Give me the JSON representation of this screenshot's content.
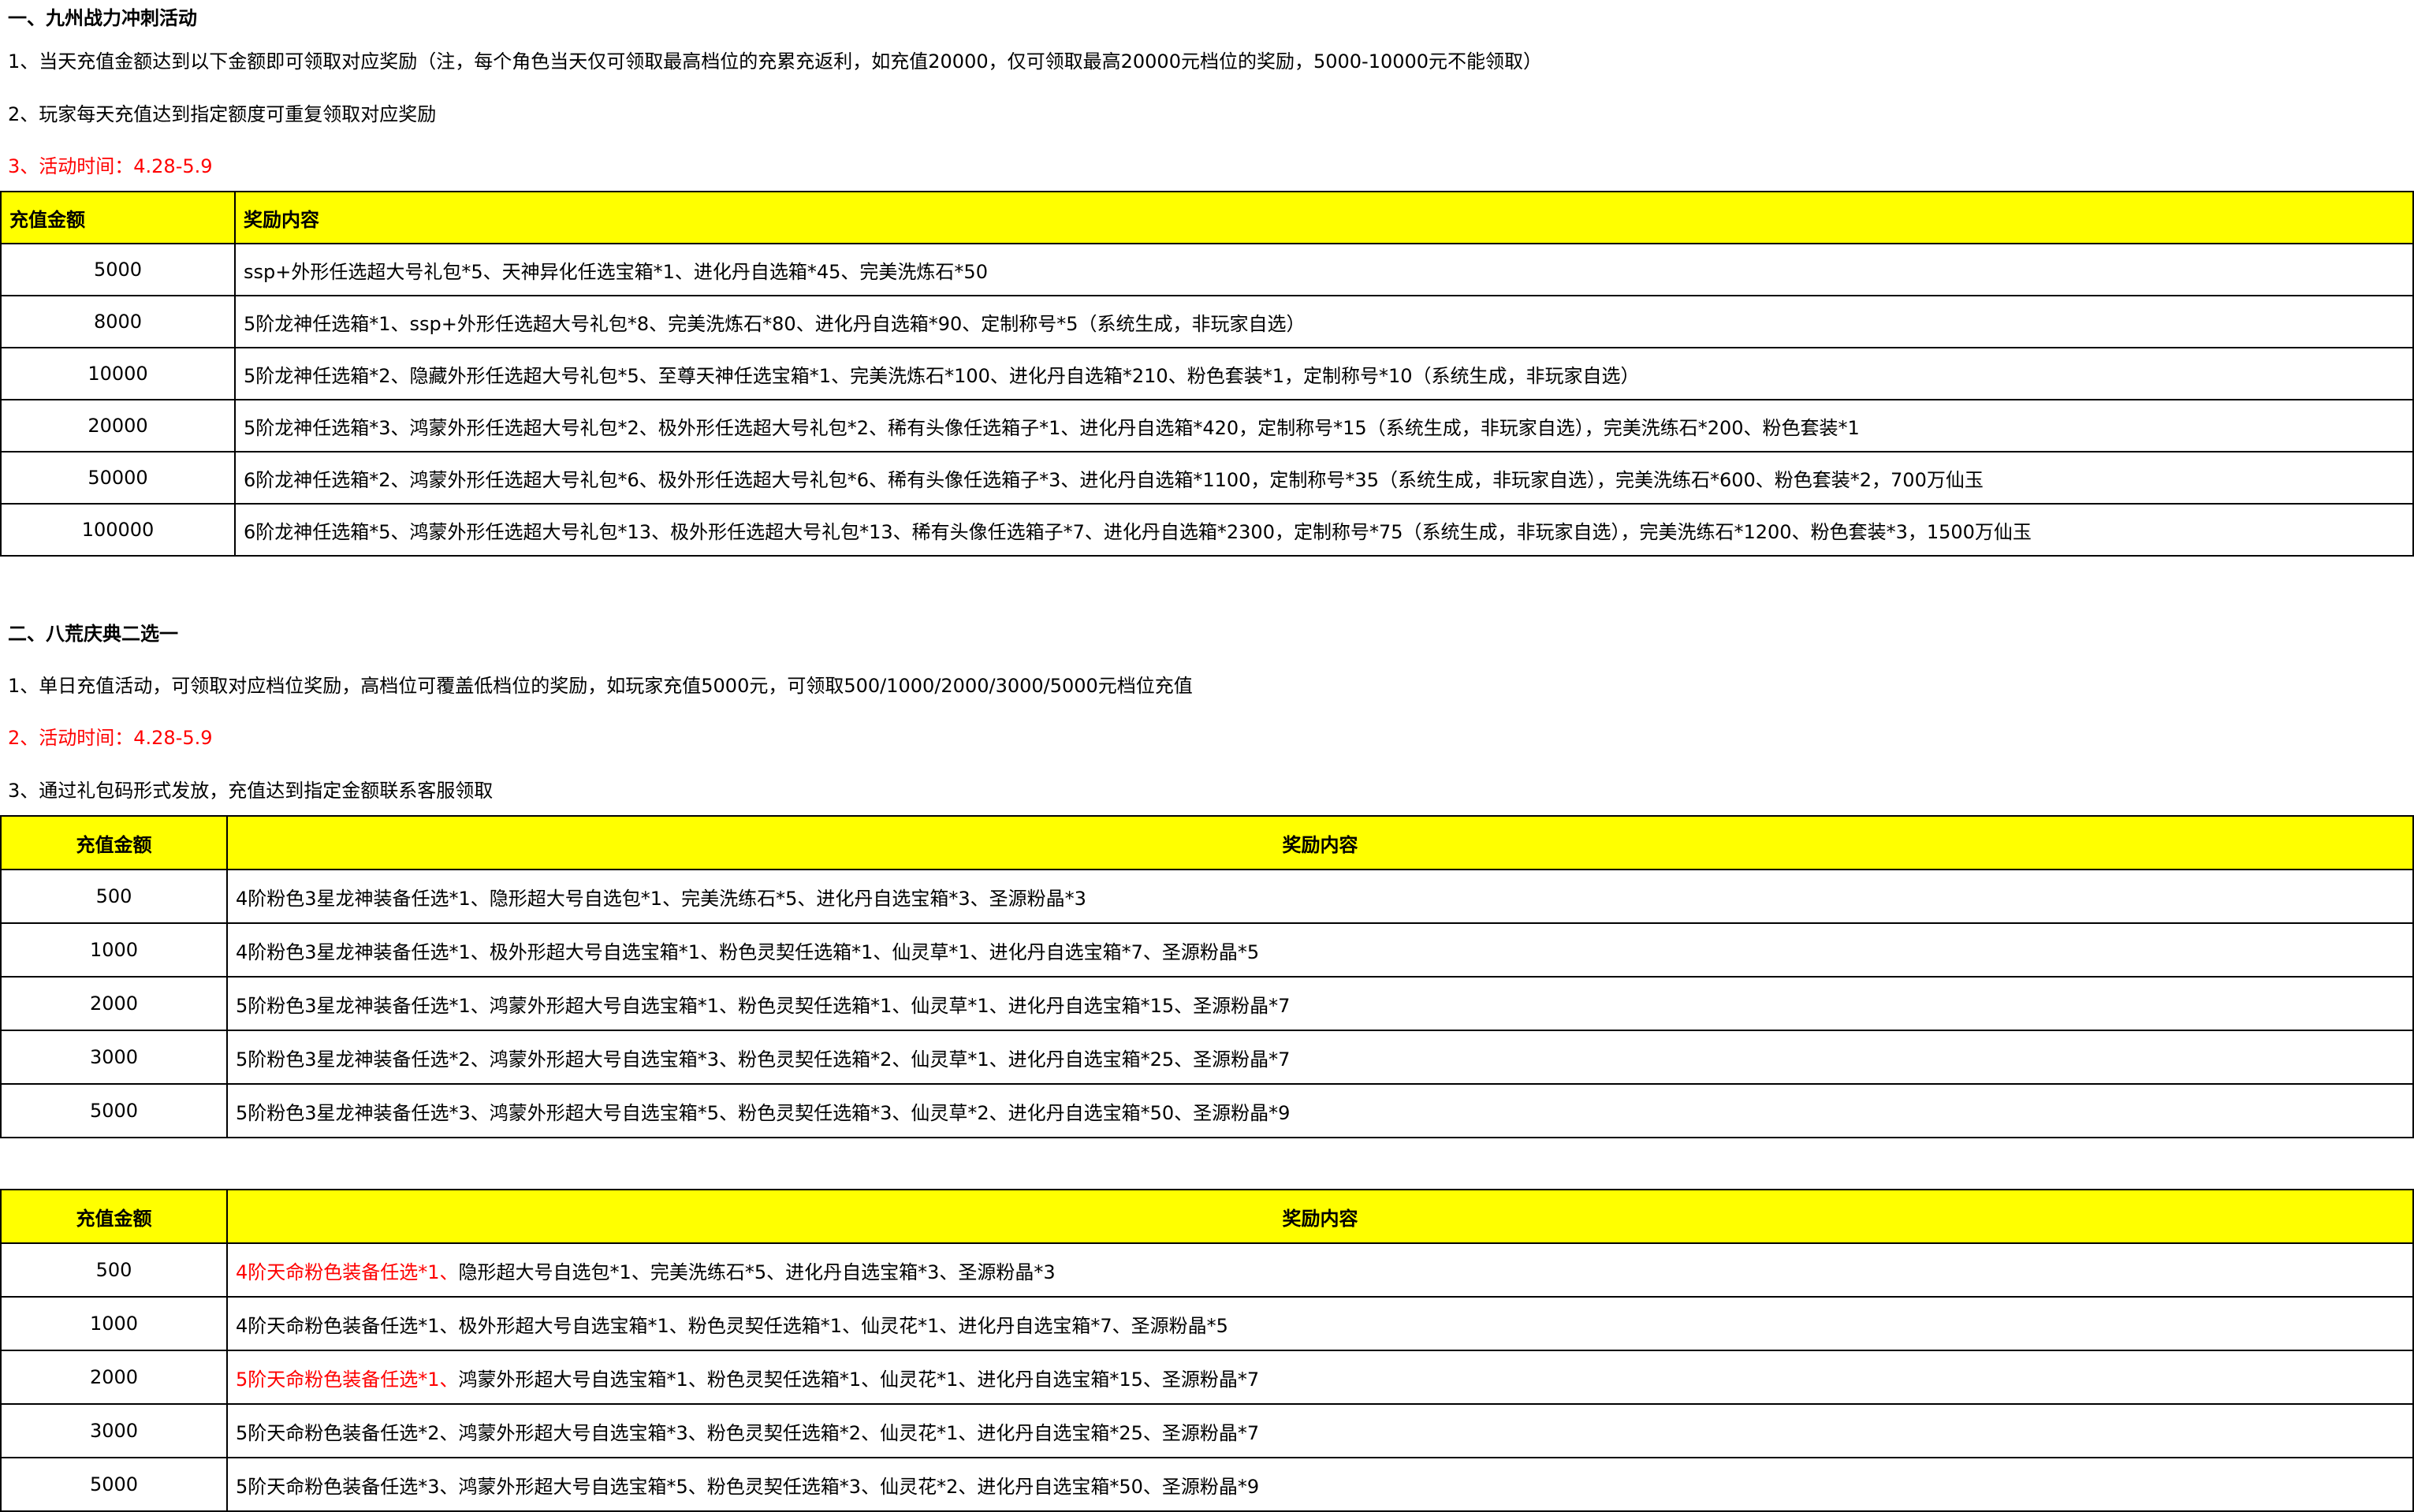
{
  "section1": {
    "title": "一、九州战力冲刺活动",
    "note1": "1、当天充值金额达到以下金额即可领取对应奖励（注，每个角色当天仅可领取最高档位的充累充返利，如充值20000，仅可领取最高20000元档位的奖励，5000-10000元不能领取）",
    "note2": "2、玩家每天充值达到指定额度可重复领取对应奖励",
    "note3": "3、活动时间：4.28-5.9",
    "table": {
      "header_amount": "充值金额",
      "header_reward": "奖励内容",
      "rows": [
        {
          "amount": "5000",
          "reward": "ssp+外形任选超大号礼包*5、天神异化任选宝箱*1、进化丹自选箱*45、完美洗炼石*50"
        },
        {
          "amount": "8000",
          "reward": "5阶龙神任选箱*1、ssp+外形任选超大号礼包*8、完美洗炼石*80、进化丹自选箱*90、定制称号*5（系统生成，非玩家自选）"
        },
        {
          "amount": "10000",
          "reward": "5阶龙神任选箱*2、隐藏外形任选超大号礼包*5、至尊天神任选宝箱*1、完美洗炼石*100、进化丹自选箱*210、粉色套装*1，定制称号*10（系统生成，非玩家自选）"
        },
        {
          "amount": "20000",
          "reward": "5阶龙神任选箱*3、鸿蒙外形任选超大号礼包*2、极外形任选超大号礼包*2、稀有头像任选箱子*1、进化丹自选箱*420，定制称号*15（系统生成，非玩家自选），完美洗练石*200、粉色套装*1"
        },
        {
          "amount": "50000",
          "reward": "6阶龙神任选箱*2、鸿蒙外形任选超大号礼包*6、极外形任选超大号礼包*6、稀有头像任选箱子*3、进化丹自选箱*1100，定制称号*35（系统生成，非玩家自选），完美洗练石*600、粉色套装*2，700万仙玉"
        },
        {
          "amount": "100000",
          "reward": "6阶龙神任选箱*5、鸿蒙外形任选超大号礼包*13、极外形任选超大号礼包*13、稀有头像任选箱子*7、进化丹自选箱*2300，定制称号*75（系统生成，非玩家自选），完美洗练石*1200、粉色套装*3，1500万仙玉"
        }
      ]
    }
  },
  "section2": {
    "title": "二、八荒庆典二选一",
    "note1": "1、单日充值活动，可领取对应档位奖励，高档位可覆盖低档位的奖励，如玩家充值5000元，可领取500/1000/2000/3000/5000元档位充值",
    "note2": "2、活动时间：4.28-5.9",
    "note3": "3、通过礼包码形式发放，充值达到指定金额联系客服领取",
    "table_a": {
      "header_amount": "充值金额",
      "header_reward": "奖励内容",
      "rows": [
        {
          "amount": "500",
          "reward": "4阶粉色3星龙神装备任选*1、隐形超大号自选包*1、完美洗练石*5、进化丹自选宝箱*3、圣源粉晶*3"
        },
        {
          "amount": "1000",
          "reward": "4阶粉色3星龙神装备任选*1、极外形超大号自选宝箱*1、粉色灵契任选箱*1、仙灵草*1、进化丹自选宝箱*7、圣源粉晶*5"
        },
        {
          "amount": "2000",
          "reward": "5阶粉色3星龙神装备任选*1、鸿蒙外形超大号自选宝箱*1、粉色灵契任选箱*1、仙灵草*1、进化丹自选宝箱*15、圣源粉晶*7"
        },
        {
          "amount": "3000",
          "reward": "5阶粉色3星龙神装备任选*2、鸿蒙外形超大号自选宝箱*3、粉色灵契任选箱*2、仙灵草*1、进化丹自选宝箱*25、圣源粉晶*7"
        },
        {
          "amount": "5000",
          "reward": "5阶粉色3星龙神装备任选*3、鸿蒙外形超大号自选宝箱*5、粉色灵契任选箱*3、仙灵草*2、进化丹自选宝箱*50、圣源粉晶*9"
        }
      ]
    },
    "table_b": {
      "header_amount": "充值金额",
      "header_reward": "奖励内容",
      "rows": [
        {
          "amount": "500",
          "reward_red": "4阶天命粉色装备任选*1、",
          "reward": "隐形超大号自选包*1、完美洗练石*5、进化丹自选宝箱*3、圣源粉晶*3"
        },
        {
          "amount": "1000",
          "reward_red": "",
          "reward": "4阶天命粉色装备任选*1、极外形超大号自选宝箱*1、粉色灵契任选箱*1、仙灵花*1、进化丹自选宝箱*7、圣源粉晶*5"
        },
        {
          "amount": "2000",
          "reward_red": "5阶天命粉色装备任选*1、",
          "reward": "鸿蒙外形超大号自选宝箱*1、粉色灵契任选箱*1、仙灵花*1、进化丹自选宝箱*15、圣源粉晶*7"
        },
        {
          "amount": "3000",
          "reward_red": "",
          "reward": "5阶天命粉色装备任选*2、鸿蒙外形超大号自选宝箱*3、粉色灵契任选箱*2、仙灵花*1、进化丹自选宝箱*25、圣源粉晶*7"
        },
        {
          "amount": "5000",
          "reward_red": "",
          "reward": "5阶天命粉色装备任选*3、鸿蒙外形超大号自选宝箱*5、粉色灵契任选箱*3、仙灵花*2、进化丹自选宝箱*50、圣源粉晶*9"
        }
      ]
    }
  },
  "colors": {
    "header_bg": "#ffff00",
    "highlight_text": "#ff0000",
    "border": "#000000"
  }
}
